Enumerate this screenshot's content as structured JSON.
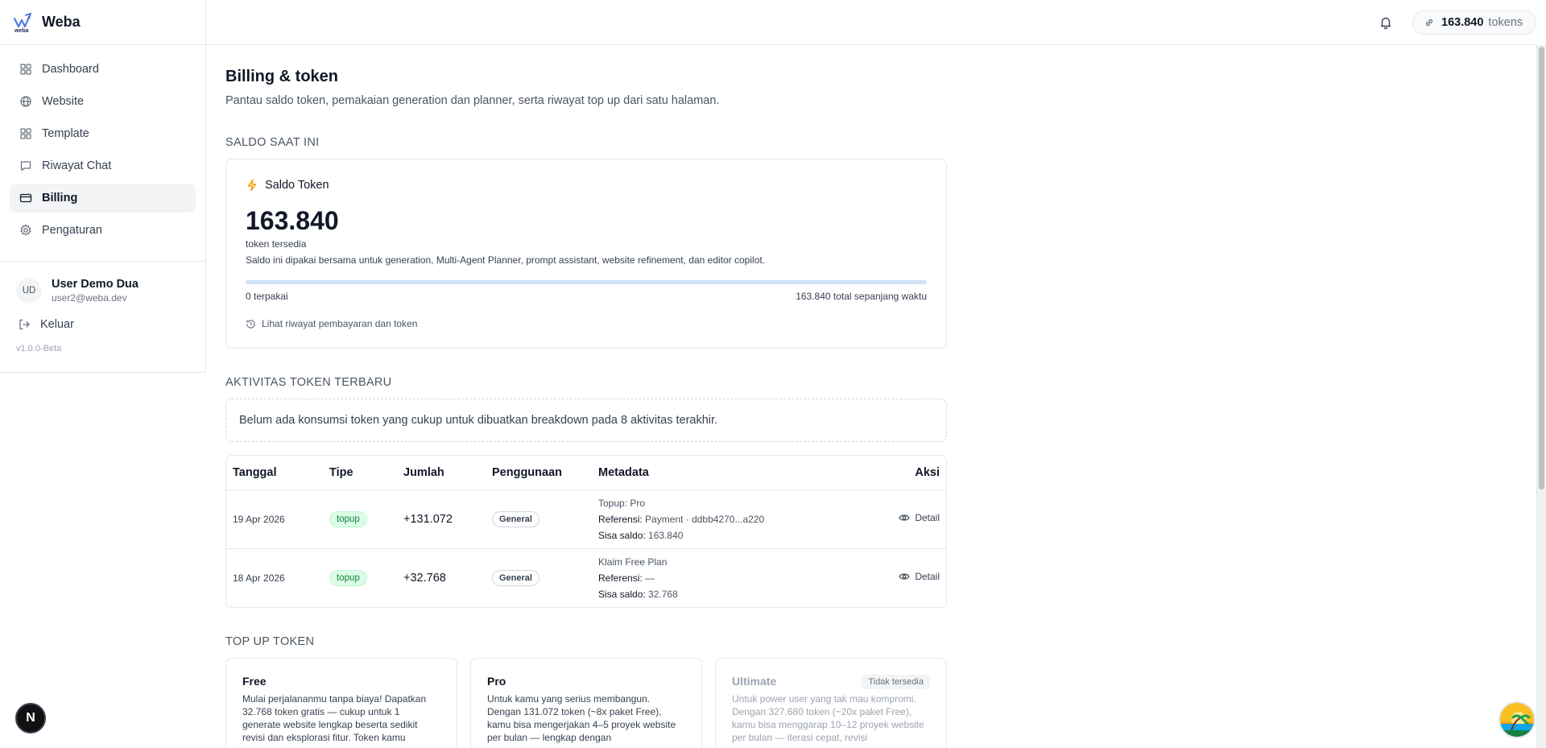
{
  "app": {
    "name": "Weba",
    "logo_text": "weba"
  },
  "sidebar": {
    "items": [
      {
        "label": "Dashboard",
        "icon": "grid-icon"
      },
      {
        "label": "Website",
        "icon": "globe-icon"
      },
      {
        "label": "Template",
        "icon": "layout-icon"
      },
      {
        "label": "Riwayat Chat",
        "icon": "message-icon"
      },
      {
        "label": "Billing",
        "icon": "credit-card-icon",
        "active": true
      },
      {
        "label": "Pengaturan",
        "icon": "gear-icon"
      }
    ],
    "user": {
      "initials": "UD",
      "name": "User Demo Dua",
      "email": "user2@weba.dev"
    },
    "logout": "Keluar",
    "version": "v1.0.0-Beta"
  },
  "topbar": {
    "token_count": "163.840",
    "token_unit": "tokens"
  },
  "page": {
    "title": "Billing & token",
    "subtitle": "Pantau saldo token, pemakaian generation dan planner, serta riwayat top up dari satu halaman."
  },
  "balance": {
    "section_title": "SALDO SAAT INI",
    "card_title": "Saldo Token",
    "amount": "163.840",
    "amount_label": "token tersedia",
    "description": "Saldo ini dipakai bersama untuk generation, Multi-Agent Planner, prompt assistant, website refinement, dan editor copilot.",
    "used_fraction": 0,
    "used_label": "0 terpakai",
    "total_label": "163.840 total sepanjang waktu",
    "history_link": "Lihat riwayat pembayaran dan token"
  },
  "activity": {
    "section_title": "AKTIVITAS TOKEN TERBARU",
    "empty_message": "Belum ada konsumsi token yang cukup untuk dibuatkan breakdown pada 8 aktivitas terakhir.",
    "columns": {
      "date": "Tanggal",
      "type": "Tipe",
      "amount": "Jumlah",
      "usage": "Penggunaan",
      "metadata": "Metadata",
      "action": "Aksi"
    },
    "rows": [
      {
        "date": "19 Apr 2026",
        "type": "topup",
        "amount": "+131.072",
        "usage": "General",
        "meta_title": "Topup: Pro",
        "ref_label": "Referensi:",
        "ref_value": "Payment · ddbb4270...a220",
        "balance_label": "Sisa saldo:",
        "balance_value": "163.840",
        "action": "Detail"
      },
      {
        "date": "18 Apr 2026",
        "type": "topup",
        "amount": "+32.768",
        "usage": "General",
        "meta_title": "Klaim Free Plan",
        "ref_label": "Referensi:",
        "ref_value": "—",
        "balance_label": "Sisa saldo:",
        "balance_value": "32.768",
        "action": "Detail"
      }
    ]
  },
  "topup": {
    "section_title": "TOP UP TOKEN",
    "plans": [
      {
        "name": "Free",
        "desc": "Mulai perjalananmu tanpa biaya! Dapatkan 32.768 token gratis — cukup untuk 1 generate website lengkap beserta sedikit revisi dan eksplorasi fitur. Token kamu",
        "tag": ""
      },
      {
        "name": "Pro",
        "desc": "Untuk kamu yang serius membangun. Dengan 131.072 token (~8x paket Free), kamu bisa mengerjakan 4–5 proyek website per bulan — lengkap dengan",
        "tag": ""
      },
      {
        "name": "Ultimate",
        "desc": "Untuk power user yang tak mau kompromi. Dengan 327.680 token (~20x paket Free), kamu bisa menggarap 10–12 proyek website per bulan — iterasi cepat, revisi",
        "tag": "Tidak tersedia"
      }
    ]
  },
  "floating": {
    "left_button": "N"
  }
}
